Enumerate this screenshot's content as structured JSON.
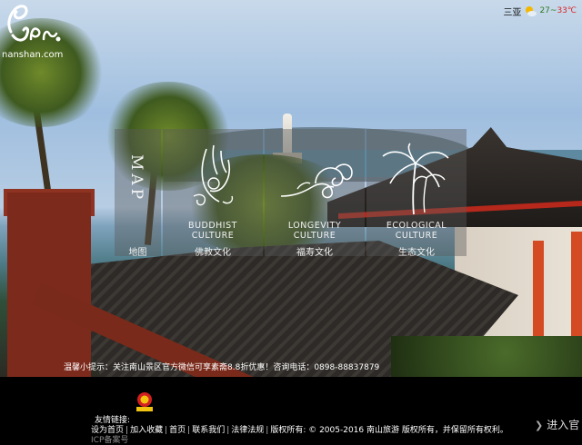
{
  "logo": {
    "url_text": "nanshan.com"
  },
  "weather": {
    "city": "三亚",
    "low": "27",
    "separator": "~",
    "high": "33℃",
    "icon": "sun-cloud-icon"
  },
  "nav": {
    "map": {
      "label_en": "MAP",
      "label_cn": "地图"
    },
    "buddhist": {
      "label_en_1": "BUDDHIST",
      "label_en_2": "CULTURE",
      "label_cn": "佛教文化",
      "icon": "buddha-hand-icon"
    },
    "longevity": {
      "label_en_1": "LONGEVITY",
      "label_en_2": "CULTURE",
      "label_cn": "福寿文化",
      "icon": "auspicious-cloud-icon"
    },
    "ecology": {
      "label_en_1": "ECOLOGICAL",
      "label_en_2": "CULTURE",
      "label_cn": "生态文化",
      "icon": "palm-tree-icon"
    }
  },
  "notice": "温馨小提示：关注南山景区官方微信可享素斋8.8折优惠！咨询电话：0898-88837879",
  "footer": {
    "friend_links_label": "友情链接:",
    "links": {
      "home": "设为首页",
      "favorite": "加入收藏",
      "index": "首页",
      "contact": "联系我们",
      "legal": "法律法规"
    },
    "copyright": "版权所有: © 2005-2016 南山旅游 版权所有，并保留所有权利。",
    "partial_line": "ICP备案号",
    "enter_label": "进入官"
  }
}
